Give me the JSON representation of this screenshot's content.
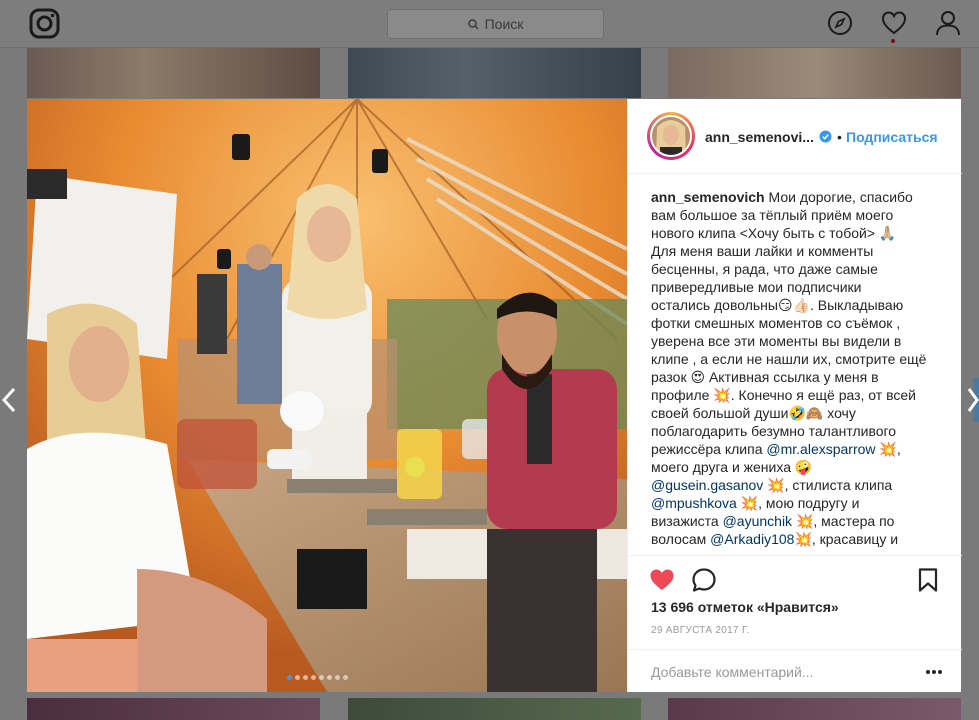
{
  "topbar": {
    "search_placeholder": "Поиск"
  },
  "icons": {
    "logo": "instagram-logo-icon",
    "explore": "compass-icon",
    "activity": "heart-outline-icon",
    "profile": "person-icon"
  },
  "post": {
    "username": "ann_semenovich",
    "username_truncated": "ann_semenovi...",
    "separator": "•",
    "follow_label": "Подписаться",
    "caption_lines": [
      " Мои дорогие, спасибо",
      "вам большое за тёплый приём моего",
      "нового клипа <Хочу быть с тобой> 🙏🏼",
      "Для меня ваши лайки и комменты",
      "бесценны, я рада, что даже самые",
      "привередливые мои подписчики",
      "остались довольны😏👍🏻. Выкладываю",
      "фотки смешных моментов со съёмок ,",
      "уверена все эти моменты вы видели в",
      "клипе , а если не нашли их, смотрите ещё",
      "разок 😍 Активная ссылка у меня в",
      "профиле 💥. Конечно я ещё раз, от всей",
      "своей большой души🤣🙈 хочу",
      "поблагодарить безумно талантливого",
      "режиссёра клипа "
    ],
    "mentions": {
      "director": "@mr.alexsparrow",
      "husband": "@gusein.gasanov",
      "stylist": "@mpushkova",
      "makeup": "@ayunchik",
      "hair": "@Arkadiy108"
    },
    "caption_tail": {
      "after_director": " 💥,",
      "friend_line": "моего друга и жениха 🤪",
      "after_husband": " 💥, стилиста клипа",
      "after_stylist": " 💥, мою подругу и",
      "makeup_prefix": "визажиста ",
      "after_makeup": " 💥, мастера по",
      "hair_prefix": "волосам ",
      "after_hair": "💥, красавицу и"
    },
    "likes_text": "13 696 отметок «Нравится»",
    "date_text": "29 АВГУСТА 2017 Г.",
    "comment_placeholder": "Добавьте комментарий...",
    "carousel": {
      "total": 8,
      "active_index": 0
    },
    "liked": true
  },
  "colors": {
    "like_red": "#ed4956",
    "link_blue": "#3897f0",
    "mention_blue": "#003569",
    "verified_blue": "#3897f0"
  }
}
